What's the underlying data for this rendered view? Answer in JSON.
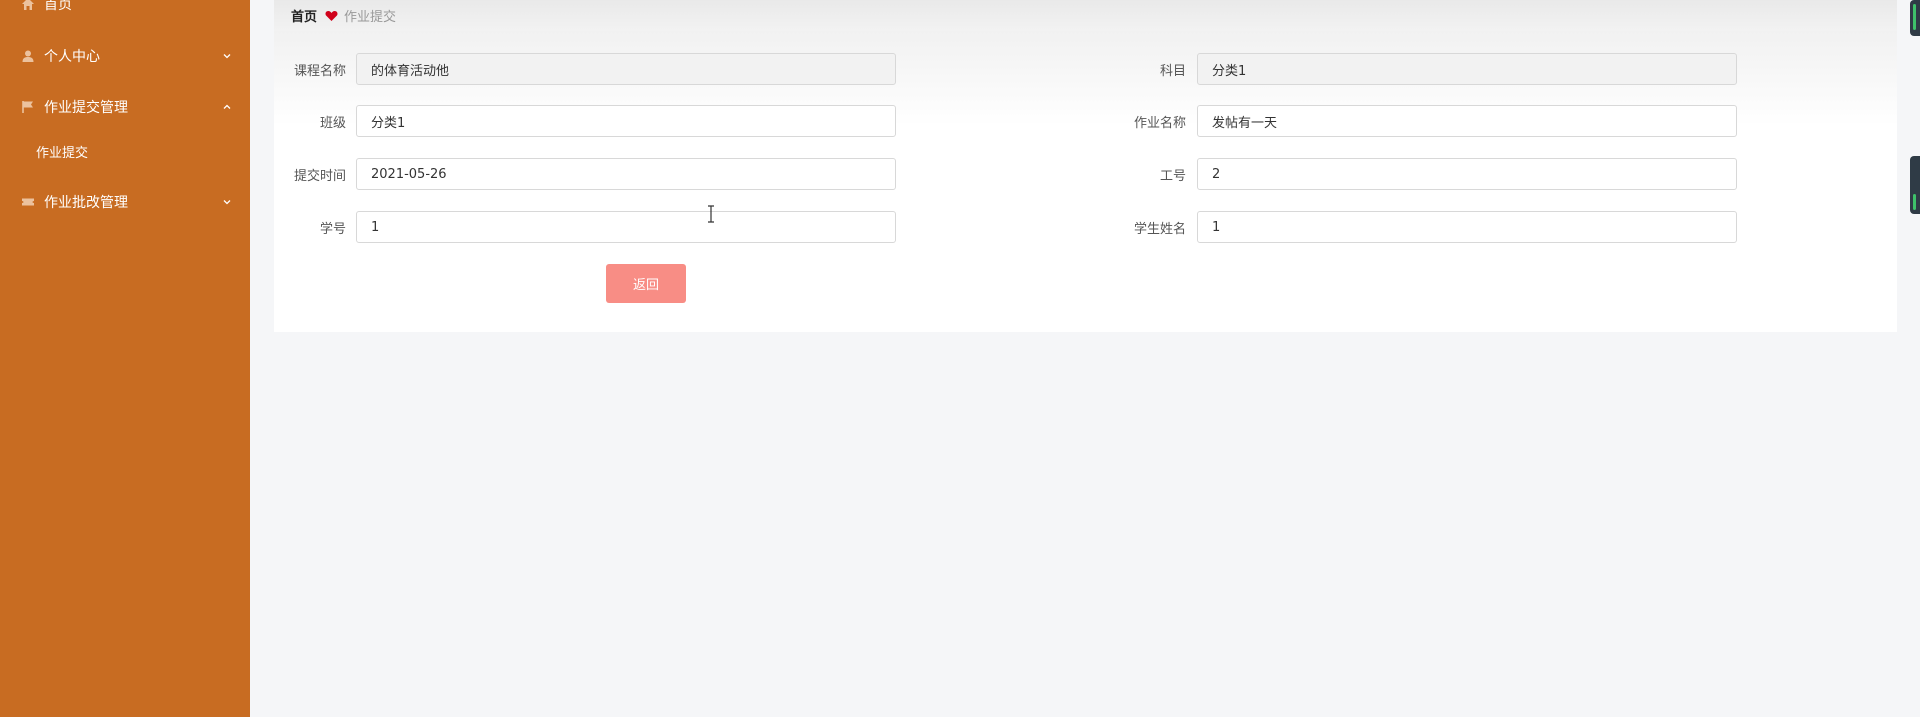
{
  "sidebar": {
    "items": [
      {
        "label": "首页",
        "icon": "home-icon"
      },
      {
        "label": "个人中心",
        "icon": "user-icon",
        "chevron": "chevron-down-icon"
      },
      {
        "label": "作业提交管理",
        "icon": "flag-icon",
        "chevron": "chevron-up-icon"
      },
      {
        "label": "作业批改管理",
        "icon": "ticket-icon",
        "chevron": "chevron-down-icon"
      }
    ],
    "subitems": [
      {
        "label": "作业提交"
      }
    ]
  },
  "breadcrumb": {
    "home": "首页",
    "current": "作业提交"
  },
  "form": {
    "course_name": {
      "label": "课程名称",
      "value": "的体育活动他"
    },
    "subject": {
      "label": "科目",
      "value": "分类1"
    },
    "class": {
      "label": "班级",
      "value": "分类1"
    },
    "homework_name": {
      "label": "作业名称",
      "value": "发帖有一天"
    },
    "submit_time": {
      "label": "提交时间",
      "value": "2021-05-26"
    },
    "staff_id": {
      "label": "工号",
      "value": "2"
    },
    "student_id": {
      "label": "学号",
      "value": "1"
    },
    "student_name": {
      "label": "学生姓名",
      "value": "1"
    }
  },
  "actions": {
    "back_label": "返回"
  },
  "colors": {
    "sidebar_bg": "#c86c22",
    "back_button": "#f88d85",
    "heart": "#d0021b"
  }
}
